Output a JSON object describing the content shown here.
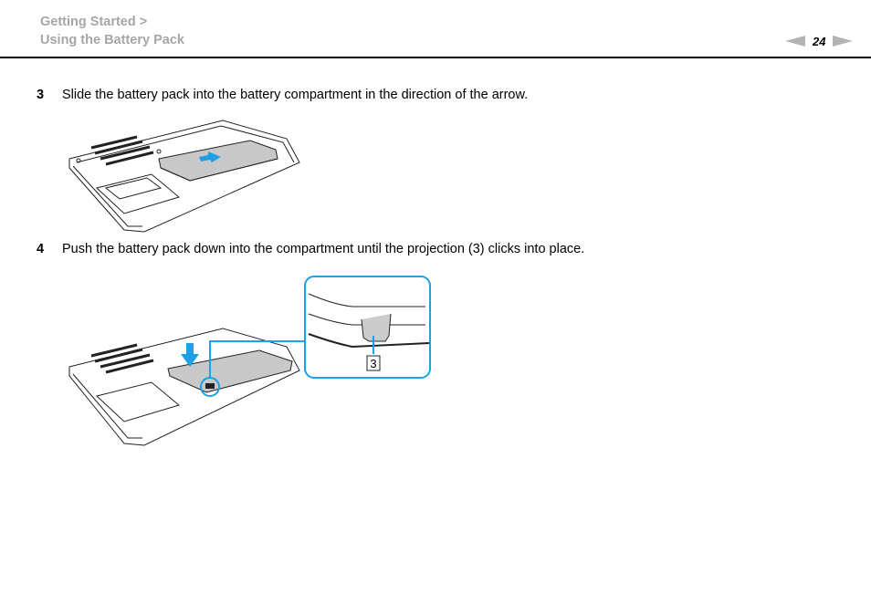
{
  "header": {
    "breadcrumb": [
      "Getting Started >",
      "Using the Battery Pack"
    ],
    "page_number": "24",
    "prev_icon": "triangle-left-icon",
    "next_icon": "triangle-right-icon"
  },
  "steps": [
    {
      "number": "3",
      "text": "Slide the battery pack into the battery compartment in the direction of the arrow."
    },
    {
      "number": "4",
      "text": "Push the battery pack down into the compartment until the projection (3) clicks into place."
    }
  ],
  "figures": {
    "fig2_callout_label": "3"
  },
  "colors": {
    "accent": "#1ea0e6",
    "battery_fill": "#c8c8c8",
    "breadcrumb": "#a6a6a6"
  }
}
